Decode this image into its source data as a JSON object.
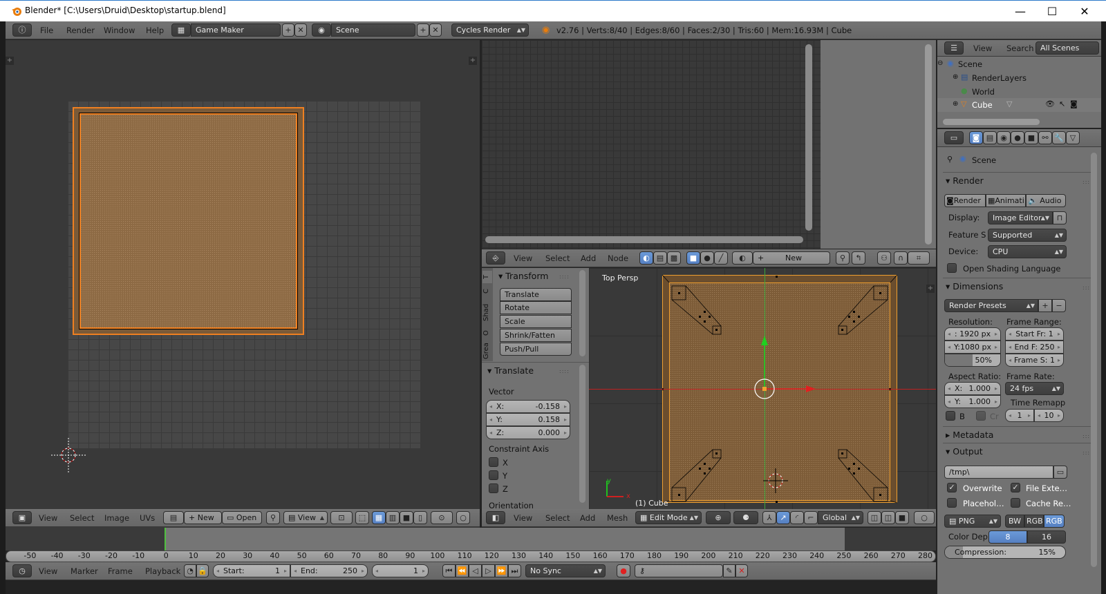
{
  "window": {
    "title": "Blender* [C:\\Users\\Druid\\Desktop\\startup.blend]",
    "minimize": "—",
    "maximize": "☐",
    "close": "✕"
  },
  "info_header": {
    "menus": [
      "File",
      "Render",
      "Window",
      "Help"
    ],
    "screen_layout": "Game Maker",
    "scene": "Scene",
    "engine": "Cycles Render",
    "stats": "v2.76 | Verts:8/40 | Edges:8/60 | Faces:2/30 | Tris:60 | Mem:16.93M | Cube"
  },
  "outliner": {
    "menus": [
      "View",
      "Search"
    ],
    "filter": "All Scenes",
    "tree": [
      {
        "label": "Scene",
        "expand": "⊖"
      },
      {
        "label": "RenderLayers",
        "expand": "⊕"
      },
      {
        "label": "World",
        "expand": ""
      },
      {
        "label": "Cube",
        "expand": "⊕"
      }
    ]
  },
  "properties": {
    "context": "Scene",
    "render_section": "Render",
    "render_buttons": [
      "Render",
      "Animati",
      "Audio"
    ],
    "display_label": "Display:",
    "display_value": "Image Editor",
    "feature_label": "Feature S",
    "feature_value": "Supported",
    "device_label": "Device:",
    "device_value": "CPU",
    "osl_label": "Open Shading Language",
    "dimensions_section": "Dimensions",
    "render_presets": "Render Presets",
    "resolution_label": "Resolution:",
    "res_x": ": 1920 px",
    "res_y": "Y:1080 px",
    "res_pct": "50%",
    "res_pct_fraction": 0.5,
    "frame_range_label": "Frame Range:",
    "start_fr": "Start Fr:  1",
    "end_fr": "End F: 250",
    "frame_step": "Frame S: 1",
    "aspect_label": "Aspect Ratio:",
    "aspect_x_label": "X:",
    "aspect_x": "1.000",
    "aspect_y_label": "Y:",
    "aspect_y": "1.000",
    "frame_rate_label": "Frame Rate:",
    "frame_rate": "24 fps",
    "time_remap_label": "Time Remapp",
    "remap_old": "1",
    "remap_new": "10",
    "border_label": "B",
    "crop_label": "Cr",
    "metadata_section": "Metadata",
    "output_section": "Output",
    "output_path": "/tmp\\",
    "overwrite_label": "Overwrite",
    "file_ext_label": "File Exte…",
    "placeholder_label": "Placehol…",
    "cache_label": "Cache Re…",
    "format": "PNG",
    "color_modes": [
      "BW",
      "RGB",
      "RGB"
    ],
    "color_depth_label": "Color Dep",
    "depths": [
      "8",
      "16"
    ],
    "compression_label": "Compression:",
    "compression_value": "15%",
    "compression_fraction": 0.15
  },
  "node_editor": {
    "menus": [
      "View",
      "Select",
      "Add",
      "Node"
    ],
    "new_label": "New"
  },
  "toolshelf": {
    "tabs": [
      "T",
      "C",
      "Shad",
      "O",
      "Grea"
    ],
    "transform_section": "Transform",
    "tools": [
      "Translate",
      "Rotate",
      "Scale",
      "Shrink/Fatten",
      "Push/Pull"
    ],
    "operator_section": "Translate",
    "vector_label": "Vector",
    "vector": [
      {
        "axis": "X:",
        "value": "-0.158"
      },
      {
        "axis": "Y:",
        "value": "0.158"
      },
      {
        "axis": "Z:",
        "value": "0.000"
      }
    ],
    "constraint_label": "Constraint Axis",
    "constraints": [
      "X",
      "Y",
      "Z"
    ],
    "orientation_label": "Orientation"
  },
  "viewport3d": {
    "view_label": "Top Persp",
    "object_label": "(1) Cube",
    "menus": [
      "View",
      "Select",
      "Add",
      "Mesh"
    ],
    "mode": "Edit Mode",
    "orientation": "Global",
    "axis_y": "y",
    "axis_x": "x"
  },
  "image_editor": {
    "menus": [
      "View",
      "Select",
      "Image",
      "UVs"
    ],
    "new_label": "New",
    "open_label": "Open",
    "view_label": "View"
  },
  "timeline": {
    "ruler": [
      "-50",
      "-40",
      "-30",
      "-20",
      "-10",
      "0",
      "10",
      "20",
      "30",
      "40",
      "50",
      "60",
      "70",
      "80",
      "90",
      "100",
      "110",
      "120",
      "130",
      "140",
      "150",
      "160",
      "170",
      "180",
      "190",
      "200",
      "210",
      "220",
      "230",
      "240",
      "250",
      "260",
      "270",
      "280"
    ],
    "current_frame": 1,
    "menus": [
      "View",
      "Marker",
      "Frame",
      "Playback"
    ],
    "start_label": "Start:",
    "start_value": "1",
    "end_label": "End:",
    "end_value": "250",
    "frame_value": "1",
    "sync": "No Sync"
  },
  "colors": {
    "accent_blue": "#5680c2",
    "selection_orange": "#f0a030",
    "mesh_brown": "#6b4e2e"
  }
}
